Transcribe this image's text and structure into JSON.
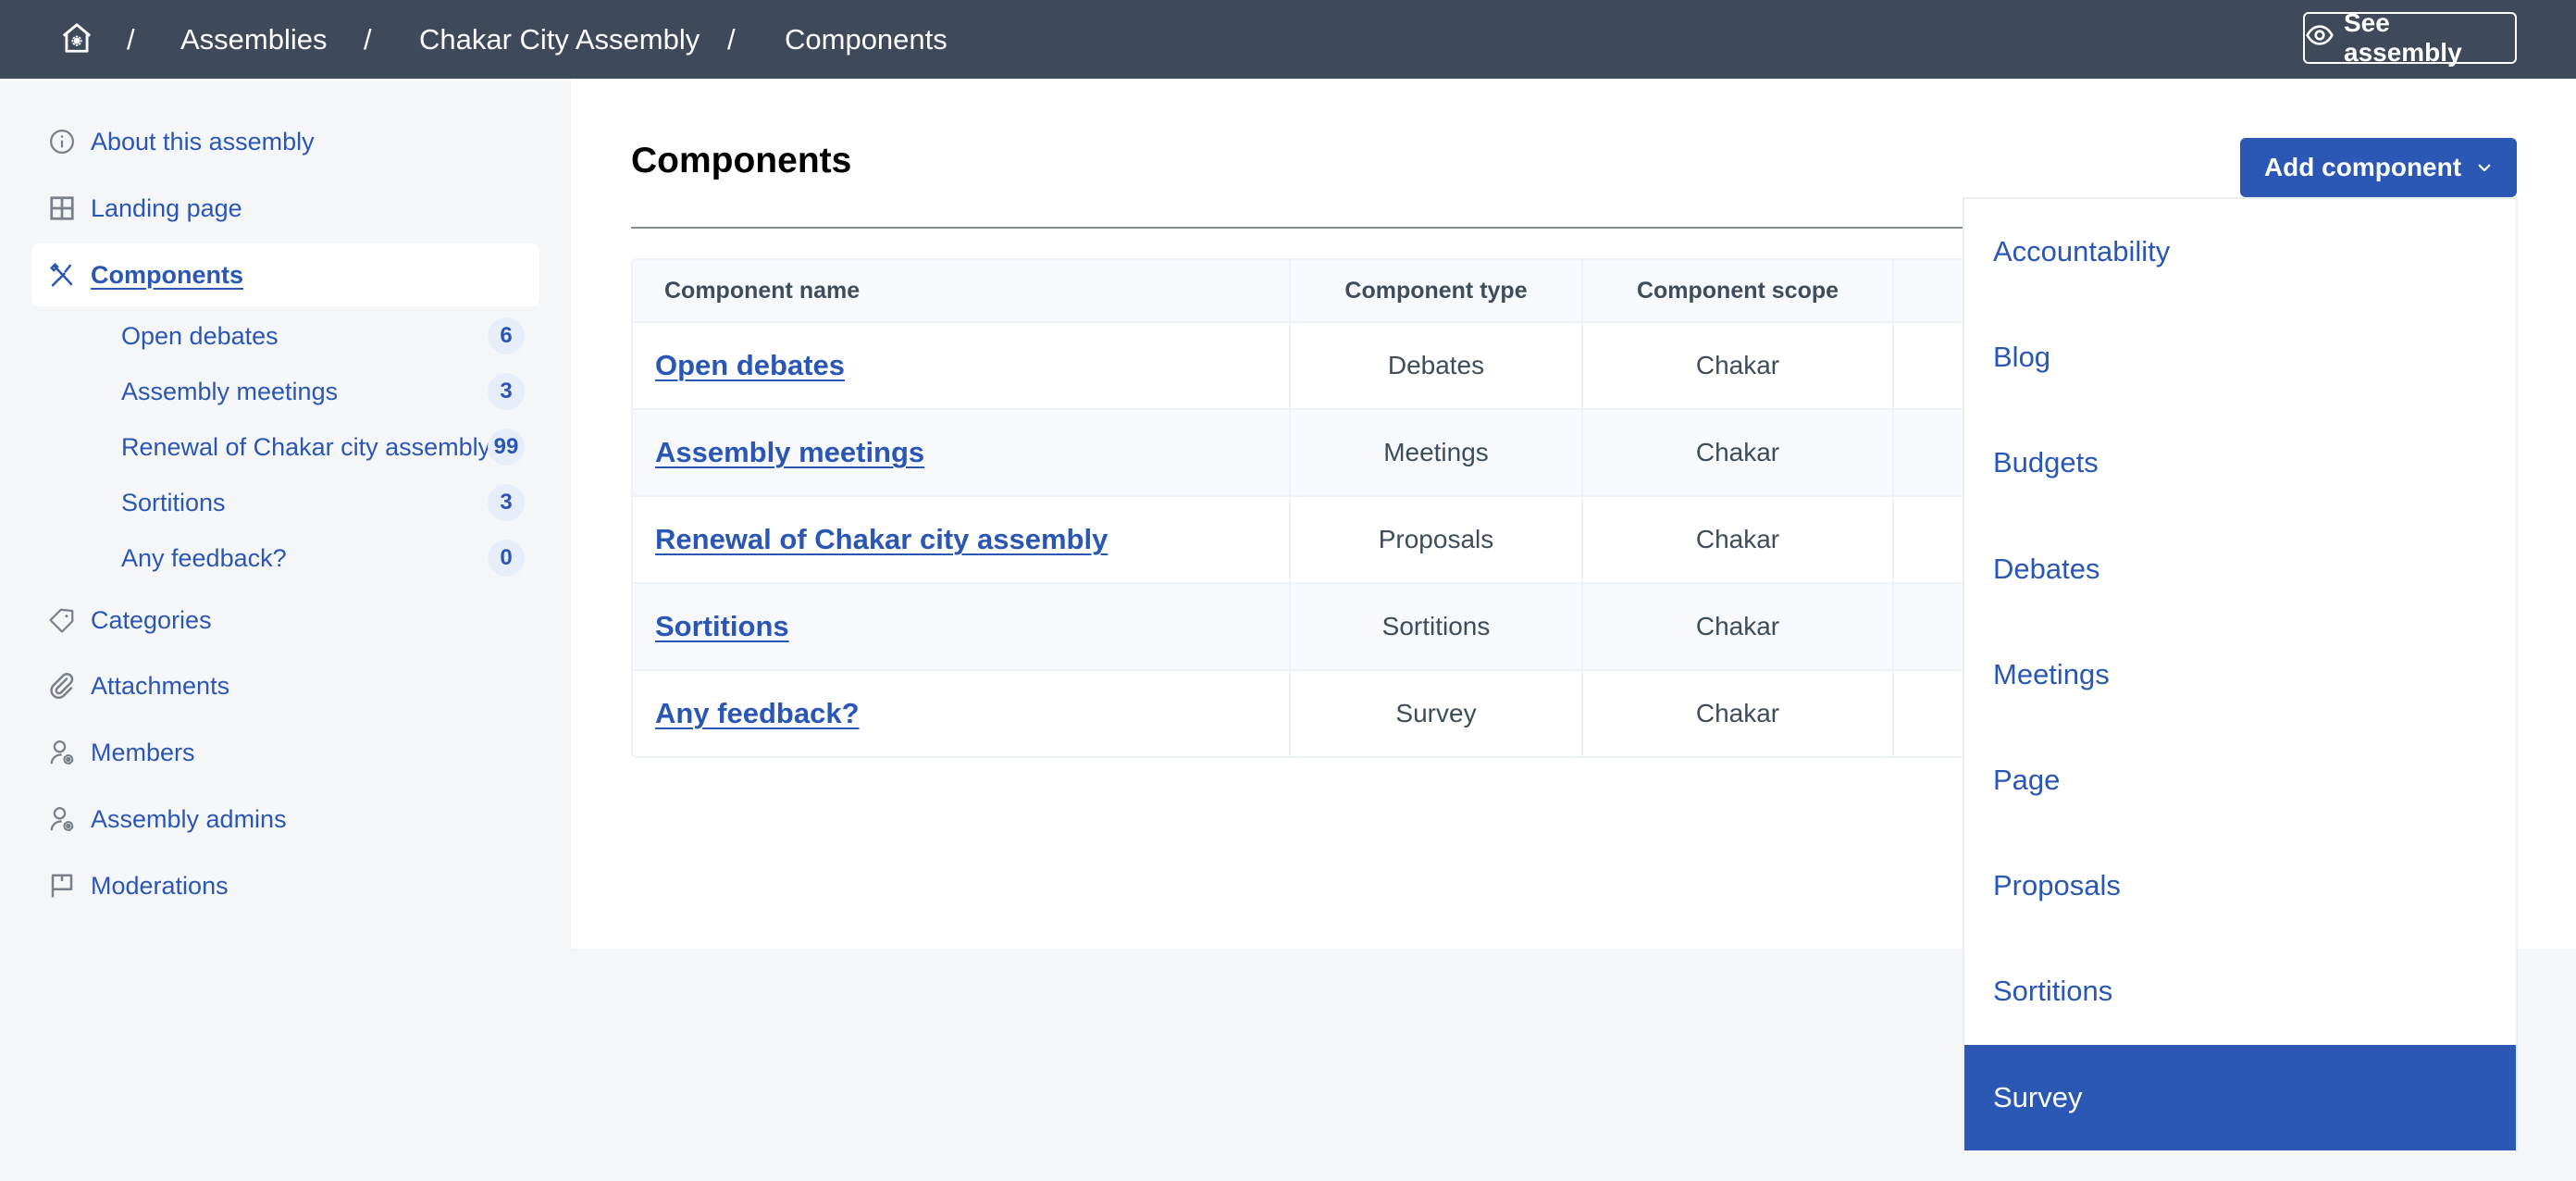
{
  "header": {
    "home_icon": "home-gear-icon",
    "breadcrumb": [
      {
        "label": "Assemblies"
      },
      {
        "label": "Chakar City Assembly"
      },
      {
        "label": "Components"
      }
    ],
    "separator": "/",
    "see_assembly": {
      "label": "See assembly",
      "icon": "eye-icon"
    }
  },
  "sidebar": {
    "items": [
      {
        "label": "About this assembly",
        "icon": "info-icon",
        "active": false
      },
      {
        "label": "Landing page",
        "icon": "layout-icon",
        "active": false
      },
      {
        "label": "Components",
        "icon": "tools-icon",
        "active": true
      },
      {
        "label": "Categories",
        "icon": "tag-icon",
        "active": false
      },
      {
        "label": "Attachments",
        "icon": "paperclip-icon",
        "active": false
      },
      {
        "label": "Members",
        "icon": "user-settings-icon",
        "active": false
      },
      {
        "label": "Assembly admins",
        "icon": "user-settings-icon",
        "active": false
      },
      {
        "label": "Moderations",
        "icon": "flag-icon",
        "active": false
      }
    ],
    "sub_items": [
      {
        "label": "Open debates",
        "count": "6"
      },
      {
        "label": "Assembly meetings",
        "count": "3"
      },
      {
        "label": "Renewal of Chakar city assembly",
        "count": "99"
      },
      {
        "label": "Sortitions",
        "count": "3"
      },
      {
        "label": "Any feedback?",
        "count": "0"
      }
    ]
  },
  "main": {
    "title": "Components",
    "add_button": {
      "label": "Add component",
      "icon": "chevron-down-icon"
    },
    "table": {
      "columns": [
        "Component name",
        "Component type",
        "Component scope"
      ],
      "rows": [
        {
          "name": "Open debates",
          "type": "Debates",
          "scope": "Chakar"
        },
        {
          "name": "Assembly meetings",
          "type": "Meetings",
          "scope": "Chakar"
        },
        {
          "name": "Renewal of Chakar city assembly",
          "type": "Proposals",
          "scope": "Chakar"
        },
        {
          "name": "Sortitions",
          "type": "Sortitions",
          "scope": "Chakar"
        },
        {
          "name": "Any feedback?",
          "type": "Survey",
          "scope": "Chakar"
        }
      ]
    },
    "dropdown": {
      "items": [
        "Accountability",
        "Blog",
        "Budgets",
        "Debates",
        "Meetings",
        "Page",
        "Proposals",
        "Sortitions",
        "Survey"
      ],
      "highlighted": "Survey"
    }
  },
  "colors": {
    "header_bg": "#3e4a5a",
    "primary": "#2b58b5",
    "link": "#2a56b5",
    "page_bg": "#f5f6f8",
    "badge_bg": "#e7eefa"
  }
}
